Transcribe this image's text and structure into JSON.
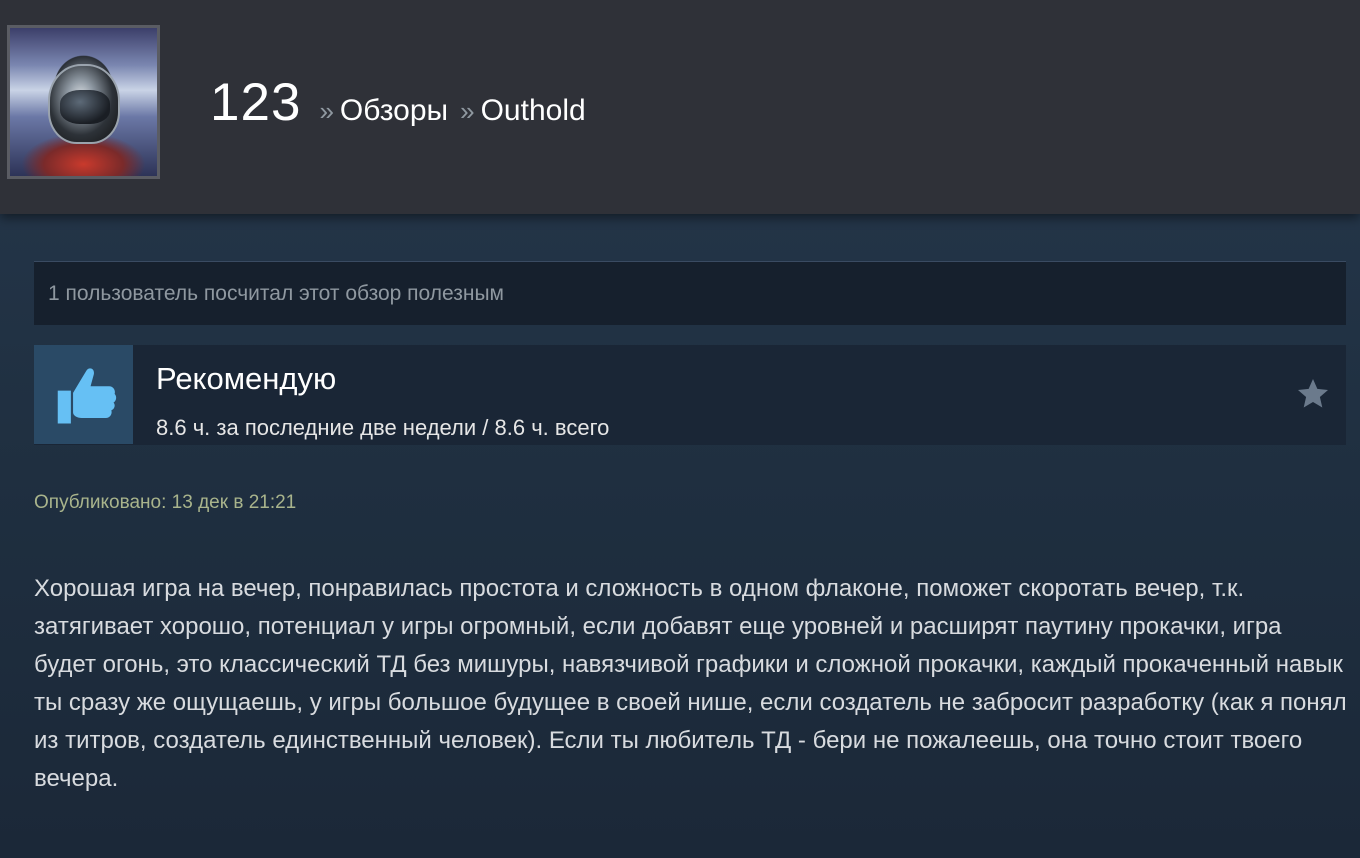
{
  "header": {
    "user_name": "123",
    "separator": "»",
    "crumb_reviews": "Обзоры",
    "crumb_game": "Outhold"
  },
  "review": {
    "helpful_text": "1 пользователь посчитал этот обзор полезным",
    "verdict": "Рекомендую",
    "hours": "8.6 ч. за последние две недели / 8.6 ч. всего",
    "published": "Опубликовано: 13 дек в 21:21",
    "body": "Хорошая игра на вечер, понравилась простота и сложность в одном флаконе, поможет скоротать вечер, т.к. затягивает хорошо, потенциал у игры огромный, если добавят еще уровней и расширят паутину прокачки, игра будет огонь, это классический ТД без мишуры, навязчивой графики и сложной прокачки, каждый прокаченный навык ты сразу же ощущаешь, у игры большое будущее в своей нише, если создатель не забросит разработку (как я понял из титров, создатель единственный человек). Если ты любитель ТД - бери не пожалеешь, она точно стоит твоего вечера."
  },
  "icons": {
    "thumb": "thumbs-up-icon",
    "award": "star-icon"
  },
  "colors": {
    "header_bg": "#2f3138",
    "thumb_blue": "#66c0f4",
    "page_bg": "#1b2838"
  }
}
